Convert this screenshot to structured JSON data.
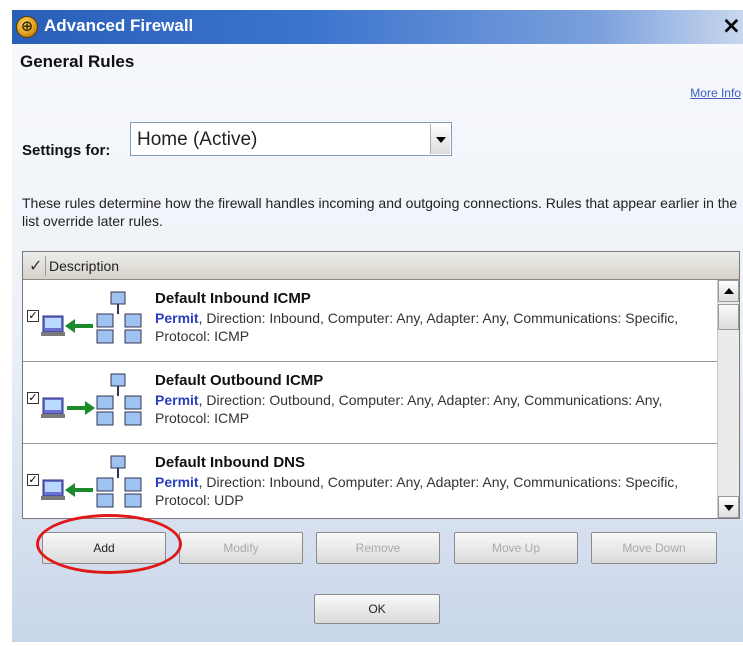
{
  "window": {
    "title": "Advanced Firewall",
    "close_glyph": "×"
  },
  "page": {
    "section_title": "General Rules",
    "more_info": "More Info",
    "settings_label": "Settings for:",
    "settings_value": "Home (Active)",
    "description": "These rules determine how the firewall handles incoming and outgoing connections. Rules that appear earlier in the list override later rules."
  },
  "rules_list": {
    "header_check": "✓",
    "header_label": "Description",
    "rows": [
      {
        "checked": "✓",
        "title": "Default Inbound ICMP",
        "action": "Permit",
        "details": ", Direction: Inbound, Computer: Any, Adapter: Any, Communications: Specific, Protocol: ICMP",
        "direction": "inbound"
      },
      {
        "checked": "✓",
        "title": "Default Outbound ICMP",
        "action": "Permit",
        "details": ", Direction: Outbound, Computer: Any, Adapter: Any, Communications: Any, Protocol: ICMP",
        "direction": "outbound"
      },
      {
        "checked": "✓",
        "title": "Default Inbound DNS",
        "action": "Permit",
        "details": ", Direction: Inbound, Computer: Any, Adapter: Any, Communications: Specific, Protocol: UDP",
        "direction": "inbound"
      }
    ]
  },
  "buttons": {
    "add": "Add",
    "modify": "Modify",
    "remove": "Remove",
    "move_up": "Move Up",
    "move_down": "Move Down",
    "ok": "OK"
  },
  "colors": {
    "title_bar": "#2a5fb8",
    "highlight": "#e01818",
    "permit": "#2a3fc0"
  },
  "icons": {
    "app": "firewall-globe-icon",
    "inbound": "inbound-connection-icon",
    "outbound": "outbound-connection-icon"
  }
}
